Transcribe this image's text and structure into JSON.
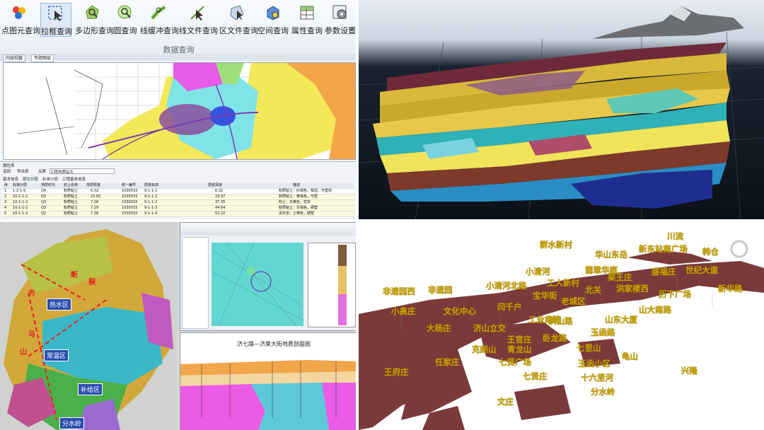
{
  "ribbon": {
    "buttons": [
      {
        "label": "点图元查询",
        "icon": "point-query-icon",
        "active": false
      },
      {
        "label": "拉框查询",
        "icon": "box-select-icon",
        "active": true
      },
      {
        "label": "多边形查询",
        "icon": "polygon-query-icon",
        "active": false
      },
      {
        "label": "圆查询",
        "icon": "circle-query-icon",
        "active": false
      },
      {
        "label": "线缓冲查询",
        "icon": "line-buffer-icon",
        "active": false
      },
      {
        "label": "线文件查询",
        "icon": "line-file-icon",
        "active": false
      },
      {
        "label": "区文件查询",
        "icon": "area-file-icon",
        "active": false
      },
      {
        "label": "空间查询",
        "icon": "spatial-query-icon",
        "active": false
      },
      {
        "label": "属性查询",
        "icon": "attribute-query-icon",
        "active": false
      },
      {
        "label": "参数设置",
        "icon": "settings-icon",
        "active": false
      }
    ],
    "group_label": "数据查询"
  },
  "window_tabs": [
    "内容视窗",
    "专题图层"
  ],
  "attribute_panel": {
    "title": "属性表",
    "toolbar": [
      "返回",
      "导出表",
      "关联"
    ],
    "filter_value": "工程地质钻孔",
    "subtabs": [
      "基本信息",
      "层位分层",
      "标准分层",
      "工程基本信息"
    ],
    "headers": [
      "序",
      "标准分层",
      "地层时代",
      "岩土名称",
      "地层厚度",
      "层底深度",
      "统一编号",
      "层底标高",
      "描述"
    ],
    "rows": [
      [
        "1",
        "1-2-1-5",
        "Q4",
        "粉质粘土",
        "6.32",
        "1030033",
        "9-1-1-1",
        "6.32",
        "粉质粘土：红褐色，稍湿，可塑状"
      ],
      [
        "2",
        "10-1-1-2",
        "Q3",
        "粉质粘土",
        "23.65",
        "1030033",
        "9-1-1-2",
        "29.97",
        "粉质粘土：黄褐色，可塑"
      ],
      [
        "3",
        "10-1-1-2",
        "Q3",
        "粉质粘土",
        "7.38",
        "1030033",
        "9-1-1-2",
        "37.35",
        "粉土：灰黄色，密实"
      ],
      [
        "4",
        "10-1-1-2",
        "Q3",
        "粉质粘土",
        "7.29",
        "1030033",
        "9-1-1-3",
        "44.64",
        "粉质粘土：灰褐色，硬塑"
      ],
      [
        "5",
        "10-1-1-2",
        "Q2",
        "粉质粘土",
        "7.38",
        "1030033",
        "9-1-1-4",
        "52.22",
        "泥灰岩：土黄色，硬塑"
      ]
    ]
  },
  "district_map": {
    "districts": [
      "热水区",
      "常温区",
      "补给区",
      "分水岭"
    ],
    "red_labels": [
      "方",
      "马",
      "山",
      "断",
      "裂"
    ]
  },
  "section_view": {
    "title": "济七路—济莱大街地质剖面图"
  },
  "place_labels": [
    "川流",
    "群水新村",
    "华山东岳",
    "新东站商广场",
    "韩仓",
    "小清河",
    "翡翠华庭",
    "盛福庄",
    "世纪大道",
    "梁王庄",
    "非遗园西",
    "非遗园",
    "小清河北路",
    "工人新村",
    "北关",
    "洪家楼西",
    "历下广场",
    "新华路",
    "小高庄",
    "文化中心",
    "宝华街",
    "老城区",
    "山大南路",
    "洪山路",
    "闫千户",
    "工业南路",
    "山东大厦",
    "大杨庄",
    "济山立交",
    "玉函路",
    "卧龙路",
    "七里山",
    "王府庄",
    "克朗山",
    "青龙山",
    "王官庄",
    "任家庄",
    "七贤广场",
    "玉函小区",
    "龟山",
    "兴隆",
    "七贤庄",
    "十六里河",
    "分水岭",
    "文庄"
  ]
}
